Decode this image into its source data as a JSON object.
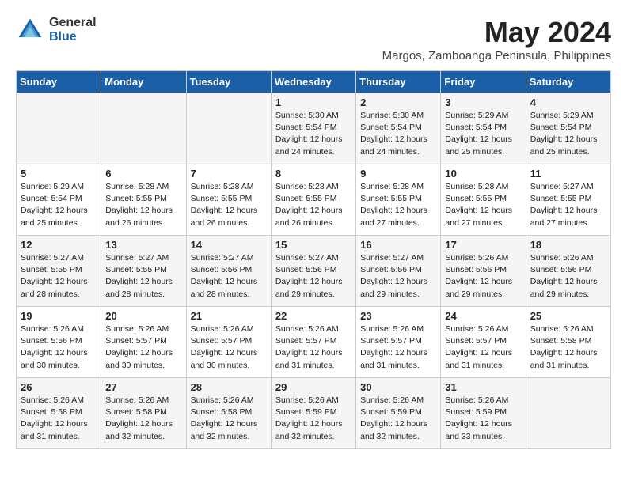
{
  "logo": {
    "general": "General",
    "blue": "Blue"
  },
  "title": {
    "month_year": "May 2024",
    "location": "Margos, Zamboanga Peninsula, Philippines"
  },
  "weekdays": [
    "Sunday",
    "Monday",
    "Tuesday",
    "Wednesday",
    "Thursday",
    "Friday",
    "Saturday"
  ],
  "weeks": [
    [
      {
        "day": "",
        "info": ""
      },
      {
        "day": "",
        "info": ""
      },
      {
        "day": "",
        "info": ""
      },
      {
        "day": "1",
        "info": "Sunrise: 5:30 AM\nSunset: 5:54 PM\nDaylight: 12 hours\nand 24 minutes."
      },
      {
        "day": "2",
        "info": "Sunrise: 5:30 AM\nSunset: 5:54 PM\nDaylight: 12 hours\nand 24 minutes."
      },
      {
        "day": "3",
        "info": "Sunrise: 5:29 AM\nSunset: 5:54 PM\nDaylight: 12 hours\nand 25 minutes."
      },
      {
        "day": "4",
        "info": "Sunrise: 5:29 AM\nSunset: 5:54 PM\nDaylight: 12 hours\nand 25 minutes."
      }
    ],
    [
      {
        "day": "5",
        "info": "Sunrise: 5:29 AM\nSunset: 5:54 PM\nDaylight: 12 hours\nand 25 minutes."
      },
      {
        "day": "6",
        "info": "Sunrise: 5:28 AM\nSunset: 5:55 PM\nDaylight: 12 hours\nand 26 minutes."
      },
      {
        "day": "7",
        "info": "Sunrise: 5:28 AM\nSunset: 5:55 PM\nDaylight: 12 hours\nand 26 minutes."
      },
      {
        "day": "8",
        "info": "Sunrise: 5:28 AM\nSunset: 5:55 PM\nDaylight: 12 hours\nand 26 minutes."
      },
      {
        "day": "9",
        "info": "Sunrise: 5:28 AM\nSunset: 5:55 PM\nDaylight: 12 hours\nand 27 minutes."
      },
      {
        "day": "10",
        "info": "Sunrise: 5:28 AM\nSunset: 5:55 PM\nDaylight: 12 hours\nand 27 minutes."
      },
      {
        "day": "11",
        "info": "Sunrise: 5:27 AM\nSunset: 5:55 PM\nDaylight: 12 hours\nand 27 minutes."
      }
    ],
    [
      {
        "day": "12",
        "info": "Sunrise: 5:27 AM\nSunset: 5:55 PM\nDaylight: 12 hours\nand 28 minutes."
      },
      {
        "day": "13",
        "info": "Sunrise: 5:27 AM\nSunset: 5:55 PM\nDaylight: 12 hours\nand 28 minutes."
      },
      {
        "day": "14",
        "info": "Sunrise: 5:27 AM\nSunset: 5:56 PM\nDaylight: 12 hours\nand 28 minutes."
      },
      {
        "day": "15",
        "info": "Sunrise: 5:27 AM\nSunset: 5:56 PM\nDaylight: 12 hours\nand 29 minutes."
      },
      {
        "day": "16",
        "info": "Sunrise: 5:27 AM\nSunset: 5:56 PM\nDaylight: 12 hours\nand 29 minutes."
      },
      {
        "day": "17",
        "info": "Sunrise: 5:26 AM\nSunset: 5:56 PM\nDaylight: 12 hours\nand 29 minutes."
      },
      {
        "day": "18",
        "info": "Sunrise: 5:26 AM\nSunset: 5:56 PM\nDaylight: 12 hours\nand 29 minutes."
      }
    ],
    [
      {
        "day": "19",
        "info": "Sunrise: 5:26 AM\nSunset: 5:56 PM\nDaylight: 12 hours\nand 30 minutes."
      },
      {
        "day": "20",
        "info": "Sunrise: 5:26 AM\nSunset: 5:57 PM\nDaylight: 12 hours\nand 30 minutes."
      },
      {
        "day": "21",
        "info": "Sunrise: 5:26 AM\nSunset: 5:57 PM\nDaylight: 12 hours\nand 30 minutes."
      },
      {
        "day": "22",
        "info": "Sunrise: 5:26 AM\nSunset: 5:57 PM\nDaylight: 12 hours\nand 31 minutes."
      },
      {
        "day": "23",
        "info": "Sunrise: 5:26 AM\nSunset: 5:57 PM\nDaylight: 12 hours\nand 31 minutes."
      },
      {
        "day": "24",
        "info": "Sunrise: 5:26 AM\nSunset: 5:57 PM\nDaylight: 12 hours\nand 31 minutes."
      },
      {
        "day": "25",
        "info": "Sunrise: 5:26 AM\nSunset: 5:58 PM\nDaylight: 12 hours\nand 31 minutes."
      }
    ],
    [
      {
        "day": "26",
        "info": "Sunrise: 5:26 AM\nSunset: 5:58 PM\nDaylight: 12 hours\nand 31 minutes."
      },
      {
        "day": "27",
        "info": "Sunrise: 5:26 AM\nSunset: 5:58 PM\nDaylight: 12 hours\nand 32 minutes."
      },
      {
        "day": "28",
        "info": "Sunrise: 5:26 AM\nSunset: 5:58 PM\nDaylight: 12 hours\nand 32 minutes."
      },
      {
        "day": "29",
        "info": "Sunrise: 5:26 AM\nSunset: 5:59 PM\nDaylight: 12 hours\nand 32 minutes."
      },
      {
        "day": "30",
        "info": "Sunrise: 5:26 AM\nSunset: 5:59 PM\nDaylight: 12 hours\nand 32 minutes."
      },
      {
        "day": "31",
        "info": "Sunrise: 5:26 AM\nSunset: 5:59 PM\nDaylight: 12 hours\nand 33 minutes."
      },
      {
        "day": "",
        "info": ""
      }
    ]
  ]
}
